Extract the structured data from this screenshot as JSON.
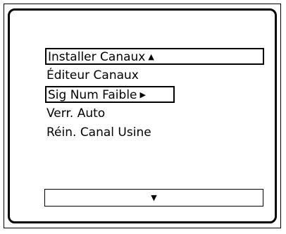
{
  "menu": {
    "items": [
      {
        "label": "Installer Canaux",
        "arrow": "▲"
      },
      {
        "label": "Éditeur Canaux"
      },
      {
        "label": "Sig Num Faible",
        "arrow": "▶"
      },
      {
        "label": "Verr. Auto"
      },
      {
        "label": "Réin. Canal Usine"
      }
    ],
    "scroll_down_arrow": "▼"
  },
  "colors": {
    "background": "#ffffff",
    "foreground": "#000000"
  },
  "icons": {
    "up": "triangle-up-icon",
    "right": "triangle-right-icon",
    "down": "triangle-down-icon"
  }
}
